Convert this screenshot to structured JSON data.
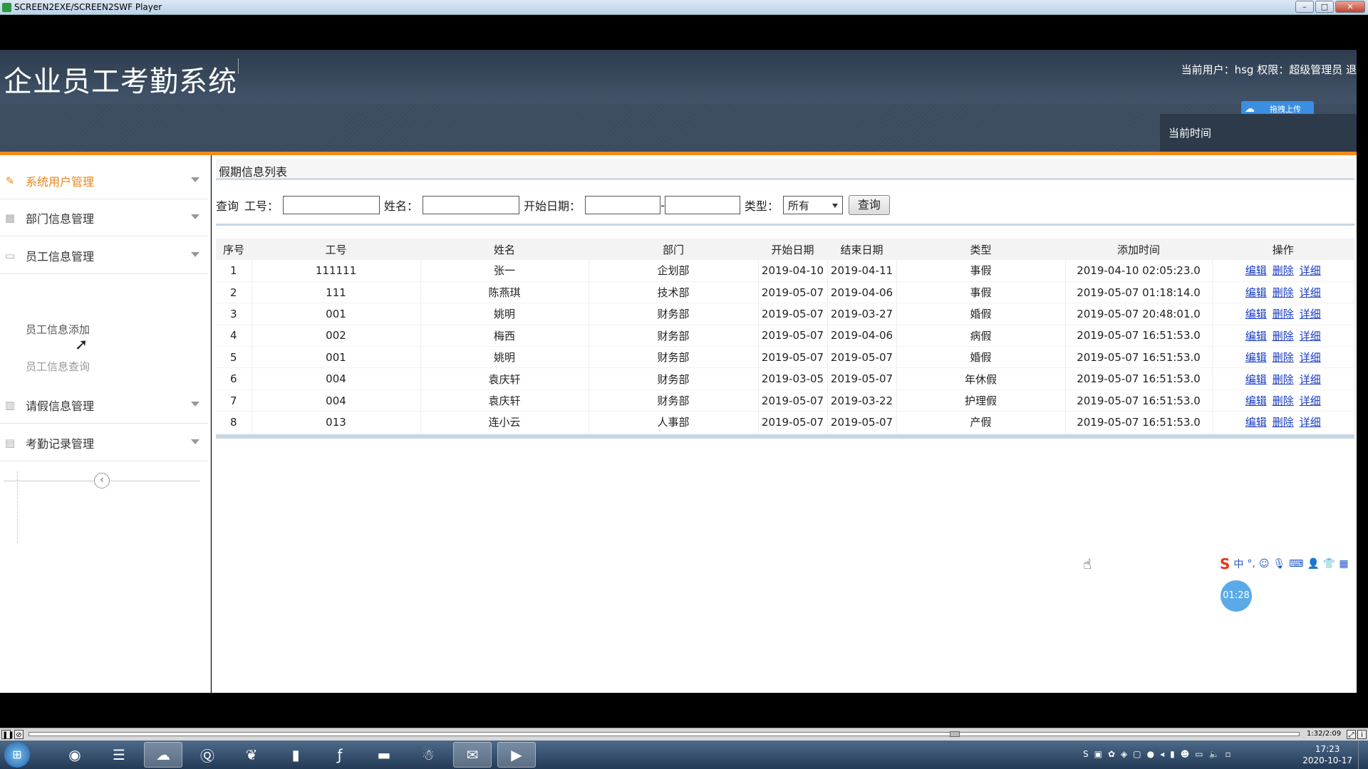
{
  "window": {
    "title": "SCREEN2EXE/SCREEN2SWF Player",
    "min": "–",
    "max": "□",
    "close": "✕"
  },
  "header": {
    "system_title": "企业员工考勤系统",
    "user_info": "当前用户：hsg 权限：超级管理员 退",
    "upload_label": "拖拽上传",
    "current_time_label": "当前时间"
  },
  "sidebar": {
    "items": [
      {
        "label": "系统用户管理",
        "icon": "pencil-icon"
      },
      {
        "label": "部门信息管理",
        "icon": "grid-icon"
      },
      {
        "label": "员工信息管理",
        "icon": "monitor-icon"
      },
      {
        "label": "请假信息管理",
        "icon": "layout-icon"
      },
      {
        "label": "考勤记录管理",
        "icon": "calendar-icon"
      }
    ],
    "sub_items": [
      "员工信息添加",
      "员工信息查询"
    ],
    "collapse": "‹"
  },
  "panel": {
    "title": "假期信息列表"
  },
  "query": {
    "query_label": "查询",
    "id_label": "工号：",
    "name_label": "姓名：",
    "date_label": "开始日期：",
    "type_label": "类型：",
    "type_value": "所有",
    "button": "查询"
  },
  "table": {
    "headers": [
      "序号",
      "工号",
      "姓名",
      "部门",
      "开始日期",
      "结束日期",
      "类型",
      "添加时间",
      "操作"
    ],
    "actions": [
      "编辑",
      "删除",
      "详细"
    ],
    "rows": [
      [
        "1",
        "111111",
        "张一",
        "企划部",
        "2019-04-10",
        "2019-04-11",
        "事假",
        "2019-04-10 02:05:23.0"
      ],
      [
        "2",
        "111",
        "陈燕琪",
        "技术部",
        "2019-05-07",
        "2019-04-06",
        "事假",
        "2019-05-07 01:18:14.0"
      ],
      [
        "3",
        "001",
        "姚明",
        "财务部",
        "2019-05-07",
        "2019-03-27",
        "婚假",
        "2019-05-07 20:48:01.0"
      ],
      [
        "4",
        "002",
        "梅西",
        "财务部",
        "2019-05-07",
        "2019-04-06",
        "病假",
        "2019-05-07 16:51:53.0"
      ],
      [
        "5",
        "001",
        "姚明",
        "财务部",
        "2019-05-07",
        "2019-05-07",
        "婚假",
        "2019-05-07 16:51:53.0"
      ],
      [
        "6",
        "004",
        "袁庆轩",
        "财务部",
        "2019-03-05",
        "2019-05-07",
        "年休假",
        "2019-05-07 16:51:53.0"
      ],
      [
        "7",
        "004",
        "袁庆轩",
        "财务部",
        "2019-05-07",
        "2019-03-22",
        "护理假",
        "2019-05-07 16:51:53.0"
      ],
      [
        "8",
        "013",
        "连小云",
        "人事部",
        "2019-05-07",
        "2019-05-07",
        "产假",
        "2019-05-07 16:51:53.0"
      ]
    ]
  },
  "ime_bar": {
    "logo": "S",
    "mode": "中"
  },
  "timer": "01:28",
  "player": {
    "time": "1:32/2:09",
    "progress": 0.73
  },
  "taskbar": {
    "clock_time": "17:23",
    "clock_date": "2020-10-17"
  }
}
